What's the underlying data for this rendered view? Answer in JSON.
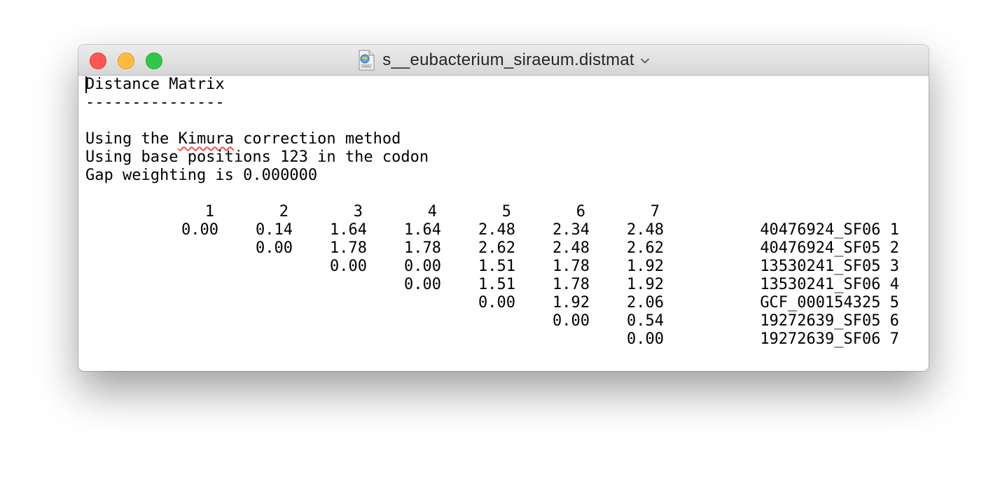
{
  "window": {
    "title": "s__eubacterium_siraeum.distmat"
  },
  "document": {
    "heading": "Distance Matrix",
    "rule": "---------------",
    "line_method_prefix": "Using the ",
    "line_method_word": "Kimura",
    "line_method_suffix": " correction method",
    "line_positions": "Using base positions 123 in the codon",
    "line_gap": "Gap weighting is 0.000000"
  },
  "matrix": {
    "column_headers": [
      "1",
      "2",
      "3",
      "4",
      "5",
      "6",
      "7"
    ],
    "rows": [
      {
        "values": [
          "0.00",
          "0.14",
          "1.64",
          "1.64",
          "2.48",
          "2.34",
          "2.48"
        ],
        "label": "40476924_SF06 1"
      },
      {
        "values": [
          "",
          "0.00",
          "1.78",
          "1.78",
          "2.62",
          "2.48",
          "2.62"
        ],
        "label": "40476924_SF05 2"
      },
      {
        "values": [
          "",
          "",
          "0.00",
          "0.00",
          "1.51",
          "1.78",
          "1.92"
        ],
        "label": "13530241_SF05 3"
      },
      {
        "values": [
          "",
          "",
          "",
          "0.00",
          "1.51",
          "1.78",
          "1.92"
        ],
        "label": "13530241_SF06 4"
      },
      {
        "values": [
          "",
          "",
          "",
          "",
          "0.00",
          "1.92",
          "2.06"
        ],
        "label": "GCF_000154325 5"
      },
      {
        "values": [
          "",
          "",
          "",
          "",
          "",
          "0.00",
          "0.54"
        ],
        "label": "19272639_SF05 6"
      },
      {
        "values": [
          "",
          "",
          "",
          "",
          "",
          "",
          "0.00"
        ],
        "label": "19272639_SF06 7"
      }
    ]
  },
  "icons": {
    "document": "distmat-document-icon",
    "title_menu": "chevron-down-icon"
  },
  "colors": {
    "close": "#fc5753",
    "minimize": "#fdbc40",
    "zoom": "#33c748",
    "spellcheck_underline": "#ff4b4b"
  }
}
